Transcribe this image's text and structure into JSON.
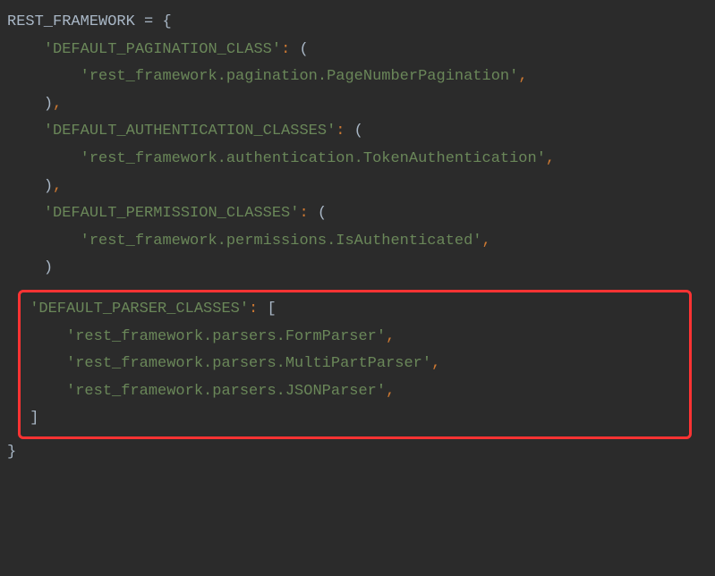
{
  "code": {
    "var_name": "REST_FRAMEWORK",
    "assign": " = ",
    "open_brace": "{",
    "close_brace": "}",
    "entries": [
      {
        "key": "'DEFAULT_PAGINATION_CLASS'",
        "colon": ": ",
        "open": "(",
        "values": [
          "'rest_framework.pagination.PageNumberPagination'"
        ],
        "close": ")",
        "comma": ","
      },
      {
        "key": "'DEFAULT_AUTHENTICATION_CLASSES'",
        "colon": ": ",
        "open": "(",
        "values": [
          "'rest_framework.authentication.TokenAuthentication'"
        ],
        "close": ")",
        "comma": ","
      },
      {
        "key": "'DEFAULT_PERMISSION_CLASSES'",
        "colon": ": ",
        "open": "(",
        "values": [
          "'rest_framework.permissions.IsAuthenticated'"
        ],
        "close": ")",
        "comma": ""
      },
      {
        "key": "'DEFAULT_PARSER_CLASSES'",
        "colon": ": ",
        "open": "[",
        "values": [
          "'rest_framework.parsers.FormParser'",
          "'rest_framework.parsers.MultiPartParser'",
          "'rest_framework.parsers.JSONParser'"
        ],
        "close": "]",
        "comma": ""
      }
    ]
  }
}
